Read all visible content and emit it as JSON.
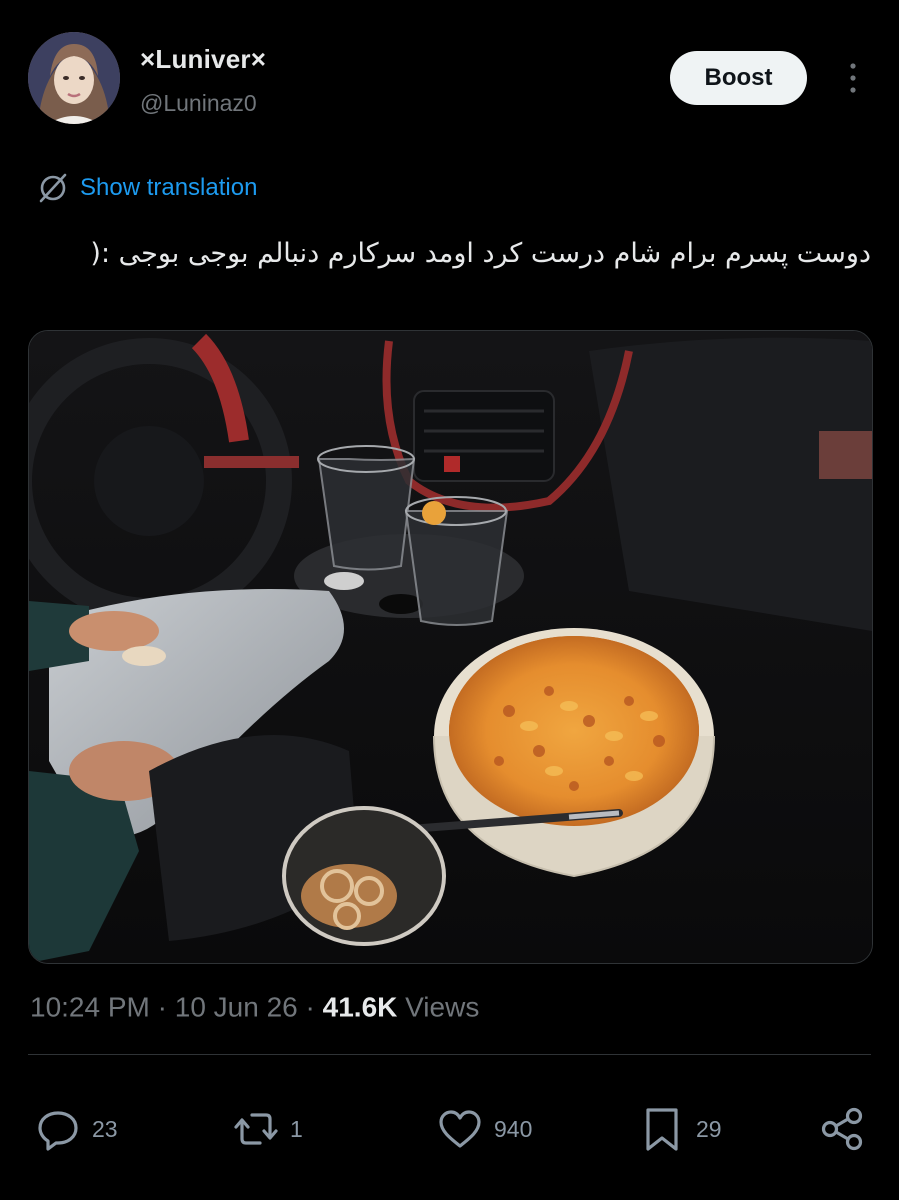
{
  "author": {
    "display_name": "×Luniver×",
    "handle": "@Luninaz0"
  },
  "header": {
    "boost_label": "Boost"
  },
  "translation": {
    "label": "Show translation"
  },
  "tweet": {
    "text": "دوست پسرم برام شام درست کرد اومد سرکارم دنبالم بوجی بوجی :("
  },
  "meta": {
    "time": "10:24 PM",
    "separator": "·",
    "date": "10 Jun 26",
    "views_count": "41.6K",
    "views_label": "Views"
  },
  "actions": {
    "replies": "23",
    "reposts": "1",
    "likes": "940",
    "bookmarks": "29"
  },
  "colors": {
    "background": "#000000",
    "text_primary": "#e7e9ea",
    "text_secondary": "#71767b",
    "accent": "#1d9bf0",
    "button_bg": "#eff3f4",
    "divider": "#2f3336"
  },
  "icons": {
    "more": "more-vertical-icon",
    "translate": "translate-icon",
    "reply": "reply-icon",
    "repost": "repost-icon",
    "like": "heart-icon",
    "bookmark": "bookmark-icon",
    "share": "share-icon"
  }
}
